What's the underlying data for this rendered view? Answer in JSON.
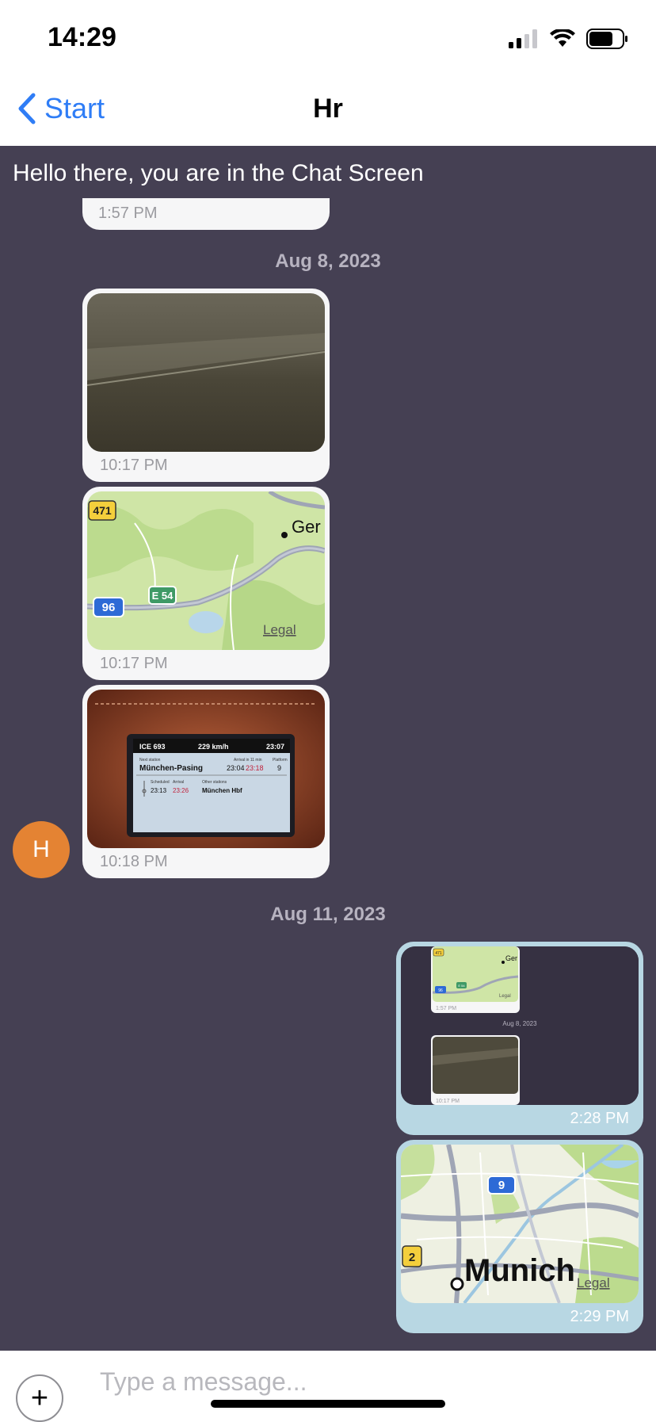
{
  "status_bar": {
    "time": "14:29"
  },
  "nav": {
    "back_label": "Start",
    "title": "Hr"
  },
  "chat": {
    "banner": "Hello there, you are in the Chat Screen",
    "partial_time": "1:57 PM",
    "dates": [
      "Aug 8, 2023",
      "Aug 11, 2023"
    ],
    "messages": [
      {
        "type": "image",
        "time": "10:17 PM"
      },
      {
        "type": "map",
        "time": "10:17 PM",
        "labels": {
          "route": "471",
          "motorway": "96",
          "euro": "E 54",
          "city": "Ger",
          "legal": "Legal"
        }
      },
      {
        "type": "image",
        "time": "10:18 PM",
        "screen": {
          "train": "ICE 693",
          "speed": "229 km/h",
          "clock": "23:07",
          "next_station_hdr": "Next station",
          "arrival_hdr": "Arrival in 11 min",
          "platform_hdr": "Platform",
          "station": "München-Pasing",
          "t1": "23:04",
          "t2": "23:18",
          "platform": "9",
          "sched_hdr": "Scheduled",
          "arr_hdr": "Arrival",
          "other_hdr": "Other stations",
          "s1": "23:13",
          "s2": "23:26",
          "other": "München Hbf"
        }
      },
      {
        "type": "screenshot",
        "time": "2:28 PM",
        "thumb": {
          "time": "1:57 PM",
          "date": "Aug 8, 2023",
          "time2": "10:17 PM",
          "route": "471",
          "motorway": "96",
          "euro": "E 54",
          "city": "Ger",
          "legal": "Legal"
        }
      },
      {
        "type": "map",
        "time": "2:29 PM",
        "labels": {
          "route": "2",
          "motorway": "9",
          "city": "Munich",
          "legal": "Legal"
        }
      }
    ],
    "avatar_letter": "H"
  },
  "composer": {
    "placeholder": "Type a message..."
  }
}
